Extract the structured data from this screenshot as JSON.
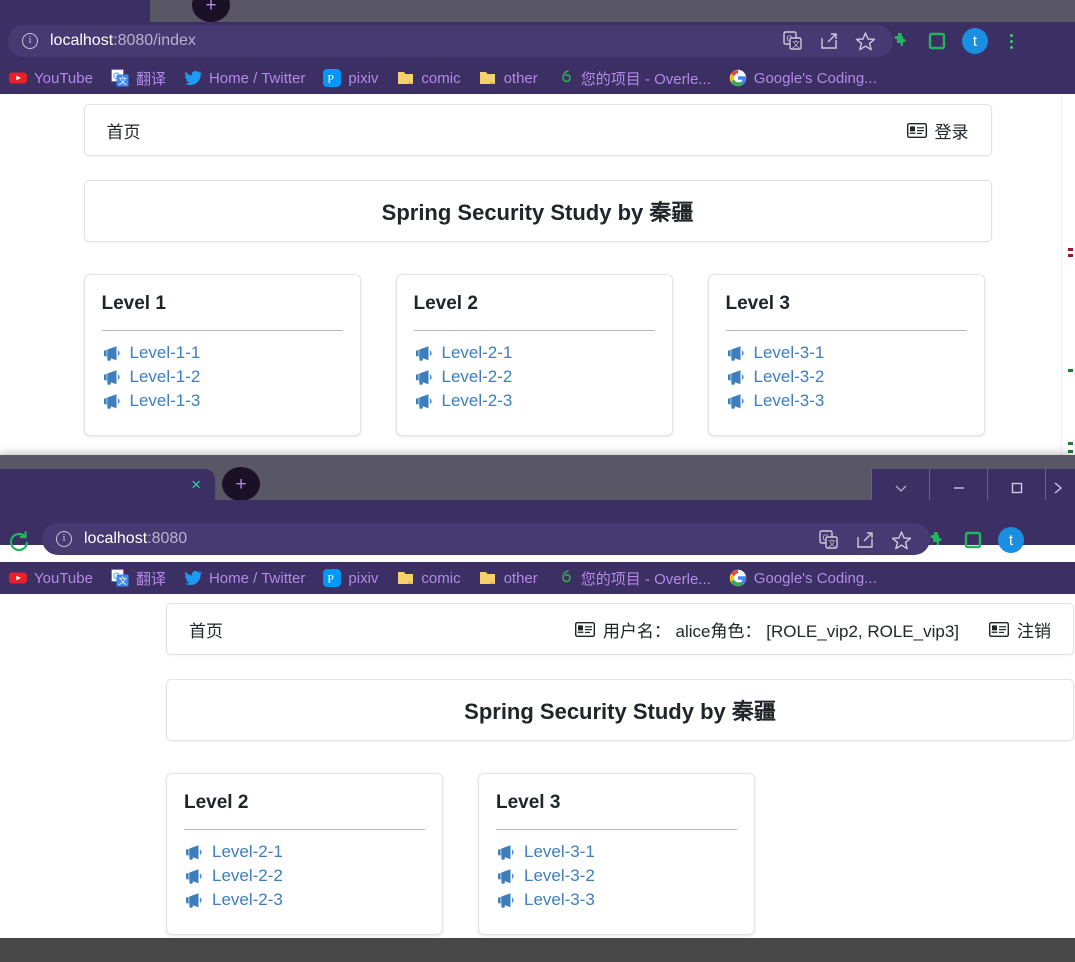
{
  "browser": {
    "window1": {
      "url_prefix": "localhost",
      "url_suffix": ":8080/index",
      "new_tab_glyph": "+"
    },
    "window2": {
      "url_prefix": "localhost",
      "url_suffix": ":8080",
      "tab_close_glyph": "×",
      "new_tab_glyph": "+"
    },
    "bookmarks": [
      {
        "label": "YouTube",
        "icon": "youtube-icon"
      },
      {
        "label": "翻译",
        "icon": "google-translate-icon"
      },
      {
        "label": "Home / Twitter",
        "icon": "twitter-icon"
      },
      {
        "label": "pixiv",
        "icon": "pixiv-icon"
      },
      {
        "label": "comic",
        "icon": "folder-icon"
      },
      {
        "label": "other",
        "icon": "folder-icon"
      },
      {
        "label": "您的项目 - Overle...",
        "icon": "overleaf-icon"
      },
      {
        "label": "Google's Coding...",
        "icon": "google-icon"
      }
    ],
    "toolbar_icons": [
      "translate-icon",
      "share-icon",
      "star-icon",
      "extensions-puzzle-icon",
      "sidepanel-icon",
      "profile-avatar"
    ],
    "avatar_letter": "t",
    "window_controls": [
      "chevron-down-icon",
      "minimize-icon",
      "maximize-icon",
      "close-icon"
    ]
  },
  "page1": {
    "nav": {
      "home_label": "首页",
      "auth_label": "登录"
    },
    "title": "Spring Security Study by 秦疆",
    "cards": [
      {
        "heading": "Level 1",
        "links": [
          "Level-1-1",
          "Level-1-2",
          "Level-1-3"
        ]
      },
      {
        "heading": "Level 2",
        "links": [
          "Level-2-1",
          "Level-2-2",
          "Level-2-3"
        ]
      },
      {
        "heading": "Level 3",
        "links": [
          "Level-3-1",
          "Level-3-2",
          "Level-3-3"
        ]
      }
    ]
  },
  "page2": {
    "nav": {
      "home_label": "首页",
      "user_info": "用户名： alice角色： [ROLE_vip2, ROLE_vip3]",
      "auth_label": "注销"
    },
    "title": "Spring Security Study by 秦疆",
    "cards": [
      {
        "heading": "Level 2",
        "links": [
          "Level-2-1",
          "Level-2-2",
          "Level-2-3"
        ]
      },
      {
        "heading": "Level 3",
        "links": [
          "Level-3-1",
          "Level-3-2",
          "Level-3-3"
        ]
      }
    ]
  },
  "colors": {
    "chrome_purple": "#3b2f63",
    "chrome_tabstrip": "#595766",
    "urlbar": "#473a73",
    "bookmark_text": "#b48ae8",
    "link_blue": "#3d7ebd",
    "accent_green": "#2fcf7a",
    "avatar_blue": "#1a8ee0"
  }
}
